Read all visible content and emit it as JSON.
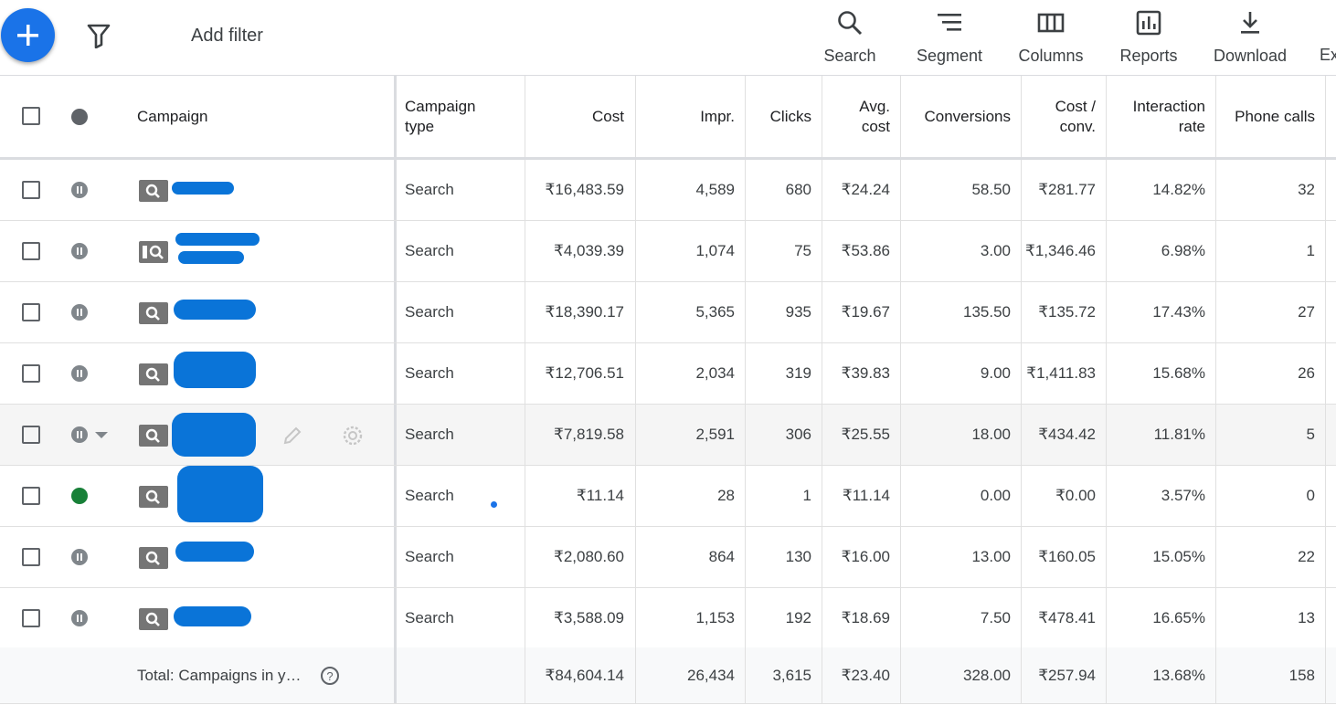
{
  "toolbar": {
    "add_filter": "Add filter",
    "tools": [
      {
        "label": "Search",
        "icon": "search-icon"
      },
      {
        "label": "Segment",
        "icon": "segment-icon"
      },
      {
        "label": "Columns",
        "icon": "columns-icon"
      },
      {
        "label": "Reports",
        "icon": "reports-icon"
      },
      {
        "label": "Download",
        "icon": "download-icon"
      }
    ],
    "overflow_label": "Ex"
  },
  "table": {
    "headers": {
      "campaign": "Campaign",
      "campaign_type_1": "Campaign",
      "campaign_type_2": "type",
      "cost": "Cost",
      "impr": "Impr.",
      "clicks": "Clicks",
      "avg_cost_1": "Avg.",
      "avg_cost_2": "cost",
      "conversions": "Conversions",
      "cost_conv_1": "Cost /",
      "cost_conv_2": "conv.",
      "interaction_1": "Interaction",
      "interaction_2": "rate",
      "phone_calls": "Phone calls"
    },
    "rows": [
      {
        "status": "paused",
        "type": "Search",
        "cost": "₹16,483.59",
        "impr": "4,589",
        "clicks": "680",
        "avg_cost": "₹24.24",
        "conversions": "58.50",
        "cost_conv": "₹281.77",
        "interaction_rate": "14.82%",
        "phone_calls": "32"
      },
      {
        "status": "paused",
        "type": "Search",
        "cost": "₹4,039.39",
        "impr": "1,074",
        "clicks": "75",
        "avg_cost": "₹53.86",
        "conversions": "3.00",
        "cost_conv": "₹1,346.46",
        "interaction_rate": "6.98%",
        "phone_calls": "1"
      },
      {
        "status": "paused",
        "type": "Search",
        "cost": "₹18,390.17",
        "impr": "5,365",
        "clicks": "935",
        "avg_cost": "₹19.67",
        "conversions": "135.50",
        "cost_conv": "₹135.72",
        "interaction_rate": "17.43%",
        "phone_calls": "27"
      },
      {
        "status": "paused",
        "type": "Search",
        "cost": "₹12,706.51",
        "impr": "2,034",
        "clicks": "319",
        "avg_cost": "₹39.83",
        "conversions": "9.00",
        "cost_conv": "₹1,411.83",
        "interaction_rate": "15.68%",
        "phone_calls": "26"
      },
      {
        "status": "paused",
        "type": "Search",
        "cost": "₹7,819.58",
        "impr": "2,591",
        "clicks": "306",
        "avg_cost": "₹25.55",
        "conversions": "18.00",
        "cost_conv": "₹434.42",
        "interaction_rate": "11.81%",
        "phone_calls": "5"
      },
      {
        "status": "enabled",
        "type": "Search",
        "cost": "₹11.14",
        "impr": "28",
        "clicks": "1",
        "avg_cost": "₹11.14",
        "conversions": "0.00",
        "cost_conv": "₹0.00",
        "interaction_rate": "3.57%",
        "phone_calls": "0"
      },
      {
        "status": "paused",
        "type": "Search",
        "cost": "₹2,080.60",
        "impr": "864",
        "clicks": "130",
        "avg_cost": "₹16.00",
        "conversions": "13.00",
        "cost_conv": "₹160.05",
        "interaction_rate": "15.05%",
        "phone_calls": "22"
      },
      {
        "status": "paused",
        "type": "Search",
        "cost": "₹3,588.09",
        "impr": "1,153",
        "clicks": "192",
        "avg_cost": "₹18.69",
        "conversions": "7.50",
        "cost_conv": "₹478.41",
        "interaction_rate": "16.65%",
        "phone_calls": "13"
      }
    ],
    "total": {
      "label": "Total: Campaigns in y…",
      "cost": "₹84,604.14",
      "impr": "26,434",
      "clicks": "3,615",
      "avg_cost": "₹23.40",
      "conversions": "328.00",
      "cost_conv": "₹257.94",
      "interaction_rate": "13.68%",
      "phone_calls": "158"
    }
  },
  "colors": {
    "accent": "#1a73e8",
    "enabled": "#188038",
    "paused": "#80868b",
    "redaction": "#0a74d8"
  }
}
